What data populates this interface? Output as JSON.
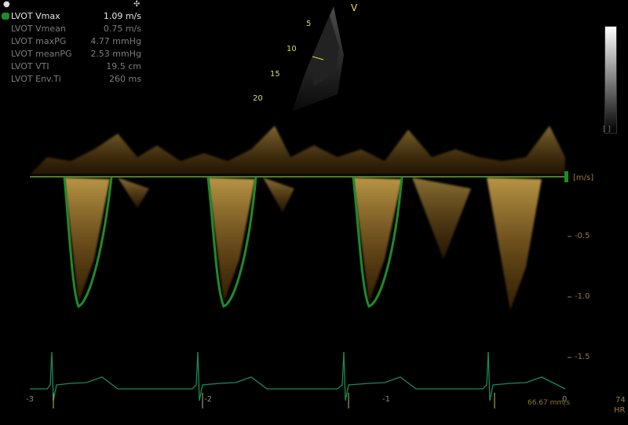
{
  "toolbar": {
    "dot_icon": "●",
    "crosshair_icon": "✣"
  },
  "measurements": [
    {
      "label": "LVOT Vmax",
      "value": "1.09 m/s",
      "active": true
    },
    {
      "label": "LVOT Vmean",
      "value": "0.75 m/s",
      "active": false
    },
    {
      "label": "LVOT maxPG",
      "value": "4.77 mmHg",
      "active": false
    },
    {
      "label": "LVOT meanPG",
      "value": "2.53 mmHg",
      "active": false
    },
    {
      "label": "LVOT VTI",
      "value": "19.5 cm",
      "active": false
    },
    {
      "label": "LVOT Env.Ti",
      "value": "260 ms",
      "active": false
    }
  ],
  "sector": {
    "marker": "V",
    "depths": [
      "5",
      "10",
      "15",
      "20"
    ]
  },
  "velocity_axis": {
    "unit": "[m/s]",
    "ticks": [
      "-0.5",
      "-1.0",
      "-1.5"
    ]
  },
  "time_axis": {
    "ticks": [
      "-3",
      "-2",
      "-1",
      "0"
    ]
  },
  "sweep_speed": "66.67 mm/s",
  "heart_rate": {
    "value": "74",
    "label": "HR"
  },
  "colors": {
    "doppler": "#e0a020",
    "trace": "#1f8a2a",
    "ecg": "#1a8a5a",
    "baseline": "#6aa040"
  }
}
